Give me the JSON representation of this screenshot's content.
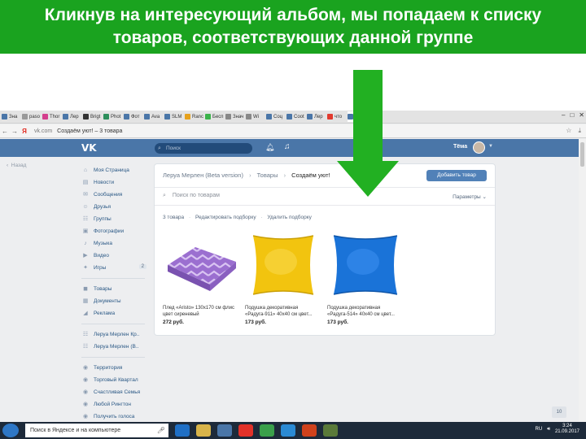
{
  "slide": {
    "title_line1": "Кликнув на интересующий альбом, мы попадаем к списку",
    "title_line2": "товаров, соответствующих данной группе"
  },
  "colors": {
    "banner": "#1aa31f",
    "arrow": "#22b022",
    "vk_blue": "#4a76a8",
    "button": "#5181b8"
  },
  "browser": {
    "tabs": [
      {
        "label": "Зна",
        "fav": "#4a76a8"
      },
      {
        "label": "pasо",
        "fav": "#999999"
      },
      {
        "label": "Thor",
        "fav": "#d43f8d"
      },
      {
        "label": "Лер",
        "fav": "#4a76a8"
      },
      {
        "label": "Brigt",
        "fav": "#333333"
      },
      {
        "label": "Phot",
        "fav": "#2d8f5c"
      },
      {
        "label": "Фот",
        "fav": "#4a76a8"
      },
      {
        "label": "Ava",
        "fav": "#4a76a8"
      },
      {
        "label": "SLM",
        "fav": "#4a76a8"
      },
      {
        "label": "Ranc",
        "fav": "#e6a11c"
      },
      {
        "label": "Бесп",
        "fav": "#3bb34a"
      },
      {
        "label": "Знач",
        "fav": "#888888"
      },
      {
        "label": "Wi",
        "fav": "#888888"
      },
      {
        "label": "Соц",
        "fav": "#4a76a8"
      },
      {
        "label": "Coot",
        "fav": "#4a76a8"
      },
      {
        "label": "Лер",
        "fav": "#4a76a8"
      },
      {
        "label": "что",
        "fav": "#e23a2e"
      },
      {
        "label": "Со",
        "fav": "#4a76a8"
      }
    ],
    "url_host": "vk.com",
    "url_title": "Создаём уют! – 3 товара",
    "yandex_mark": "Я"
  },
  "vk": {
    "logo": "VK",
    "search_placeholder": "Поиск",
    "user_name": "Тёма",
    "back_label": "Назад"
  },
  "sidebar": {
    "group1": [
      {
        "label": "Моя Страница",
        "icon": "home-icon"
      },
      {
        "label": "Новости",
        "icon": "news-icon"
      },
      {
        "label": "Сообщения",
        "icon": "messages-icon"
      },
      {
        "label": "Друзья",
        "icon": "friends-icon"
      },
      {
        "label": "Группы",
        "icon": "groups-icon"
      },
      {
        "label": "Фотографии",
        "icon": "photos-icon"
      },
      {
        "label": "Музыка",
        "icon": "music-icon"
      },
      {
        "label": "Видео",
        "icon": "video-icon"
      },
      {
        "label": "Игры",
        "icon": "games-icon",
        "count": "2"
      }
    ],
    "group2": [
      {
        "label": "Товары",
        "icon": "goods-icon"
      },
      {
        "label": "Документы",
        "icon": "documents-icon"
      },
      {
        "label": "Реклама",
        "icon": "ads-icon"
      }
    ],
    "group3": [
      {
        "label": "Леруа Мерлен Кр..",
        "icon": "group-icon"
      },
      {
        "label": "Леруа Мерлен (В..",
        "icon": "group-icon"
      }
    ],
    "group4": [
      {
        "label": "Территория",
        "icon": "app-icon"
      },
      {
        "label": "Торговый Квартал",
        "icon": "app-icon"
      },
      {
        "label": "Счастливая Семья",
        "icon": "app-icon"
      },
      {
        "label": "Любой Рингтон",
        "icon": "app-icon"
      },
      {
        "label": "Получить голоса",
        "icon": "app-icon"
      }
    ]
  },
  "main": {
    "crumb_group": "Леруа Мерлен (Beta version)",
    "crumb_section": "Товары",
    "crumb_current": "Создаём уют!",
    "add_button": "Добавить товар",
    "search_placeholder": "Поиск по товарам",
    "params_label": "Параметры",
    "count_label": "3 товара",
    "edit_label": "Редактировать подборку",
    "delete_label": "Удалить подборку",
    "products": [
      {
        "name": "Плед «Aristo» 130x170 см флис цвет сиреневый",
        "price": "272 руб.",
        "color": "#9b6fd0"
      },
      {
        "name": "Подушка декоративная «Радуга-911» 40x40 см цвет...",
        "price": "173 руб.",
        "color": "#f2c40f"
      },
      {
        "name": "Подушка декоративная «Радуга-514» 40x40 см цвет...",
        "price": "173 руб.",
        "color": "#1a73d8"
      }
    ]
  },
  "pager": "10",
  "taskbar": {
    "search_placeholder": "Поиск в Яндексе и на компьютере",
    "lang": "RU",
    "time": "3:24",
    "date": "21.09.2017",
    "apps": [
      "#1f6fc5",
      "#d8b44a",
      "#4a76a8",
      "#e2322a",
      "#3aa04b",
      "#2a8ad4",
      "#d0421c",
      "#5a7a3a"
    ]
  }
}
